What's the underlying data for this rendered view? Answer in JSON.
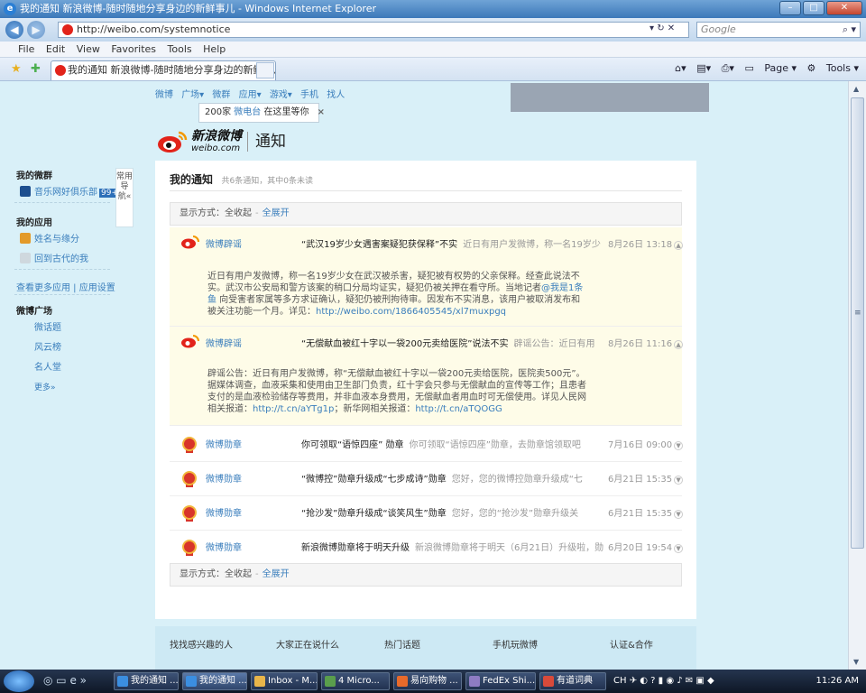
{
  "browser": {
    "title": "我的通知 新浪微博-随时随地分享身边的新鲜事儿 - Windows Internet Explorer",
    "url": "http://weibo.com/systemnotice",
    "search_placeholder": "Google",
    "tab_title": "我的通知 新浪微博-随时随地分享身边的新鲜事儿",
    "menu": [
      "File",
      "Edit",
      "View",
      "Favorites",
      "Tools",
      "Help"
    ],
    "cmd_page": "Page",
    "cmd_tools": "Tools"
  },
  "site": {
    "topnav": [
      "微博",
      "广场▾",
      "微群",
      "应用▾",
      "游戏▾",
      "手机",
      "找人"
    ],
    "tv_box": {
      "prefix": "200家",
      "link": "微电台",
      "suffix": "在这里等你",
      "close": "×"
    },
    "logo_text": "新浪微博",
    "logo_sub": "weibo.com",
    "page_title": "通知"
  },
  "sidebar": {
    "my_weiqun": "我的微群",
    "weiqun_item": "音乐网好俱乐部",
    "weiqun_badge": "99+",
    "my_apps": "我的应用",
    "app1": "姓名与缘分",
    "app2": "回到古代的我",
    "more_apps": "查看更多应用",
    "app_settings": "应用设置",
    "square": "微博广场",
    "square_items": [
      "微话题",
      "风云榜",
      "名人堂"
    ],
    "more": "更多»",
    "changyong": "常用导航«"
  },
  "notices": {
    "header_title": "我的通知",
    "header_sub": "共6条通知，其中0条未读",
    "display_label": "显示方式：",
    "collapse_all": "全收起",
    "expand_all": "全展开",
    "items": [
      {
        "sender": "微博辟谣",
        "subject": "“武汉19岁少女遇害案疑犯获保释”不实",
        "preview": "近日有用户发微博，称一名19岁少",
        "time": "8月26日 13:18",
        "body": "近日有用户发微博，称一名19岁少女在武汉被杀害，疑犯被有权势的父亲保释。经查此说法不实。武汉市公安局和警方该案的稍口分局均证实，疑犯仍被关押在看守所。当地记者",
        "body_link": "@我是1条鱼",
        "body_after": " 向受害者家属等多方求证确认，疑犯仍被刑拘待审。因发布不实消息，该用户被取消发布和被关注功能一个月。详见：",
        "body_url": "http://weibo.com/1866405545/xl7muxpgq"
      },
      {
        "sender": "微博辟谣",
        "subject": "“无偿献血被红十字以一袋200元卖给医院”说法不实",
        "preview": "辟谣公告：近日有用",
        "time": "8月26日 11:16",
        "body": "辟谣公告：近日有用户发微博，称“无偿献血被红十字以一袋200元卖给医院，医院卖500元”。据媒体调查，血液采集和使用由卫生部门负责，红十字会只参与无偿献血的宣传等工作；且患者支付的是血液检验储存等费用，并非血液本身费用，无偿献血者用血时可无偿使用。详见人民网相关报道：",
        "body_link": "http://t.cn/aYTg1p",
        "body_after": "；新华网相关报道：",
        "body_url": "http://t.cn/aTQOGG"
      },
      {
        "sender": "微博勋章",
        "subject": "你可领取“语惊四座” 勋章",
        "preview": "你可领取“语惊四座”勋章，去勋章馆领取吧",
        "time": "7月16日 09:00"
      },
      {
        "sender": "微博勋章",
        "subject": "“微博控”勋章升级成“七步成诗”勋章",
        "preview": "您好，您的微博控勋章升级成“七",
        "time": "6月21日 15:35"
      },
      {
        "sender": "微博勋章",
        "subject": "“抢沙发”勋章升级成“谈笑风生”勋章",
        "preview": "您好，您的“抢沙发”勋章升级关",
        "time": "6月21日 15:35"
      },
      {
        "sender": "微博勋章",
        "subject": "新浪微博勋章将于明天升级",
        "preview": "新浪微博勋章将于明天（6月21日）升级啦，勋",
        "time": "6月20日 19:54"
      }
    ]
  },
  "footer": [
    "找找感兴趣的人",
    "大家正在说什么",
    "热门话题",
    "手机玩微博",
    "认证&合作"
  ],
  "taskbar": {
    "buttons": [
      "我的通知 ...",
      "我的通知 ...",
      "Inbox - M...",
      "4 Micro...",
      "易向购物 ...",
      "FedEx Shi...",
      "有道词典"
    ],
    "tray_lang": "CH",
    "clock": "11:26 AM"
  },
  "colors": {
    "link": "#3a7ebc",
    "expanded_bg": "#fefce8",
    "page_bg": "#d9f0f8"
  }
}
